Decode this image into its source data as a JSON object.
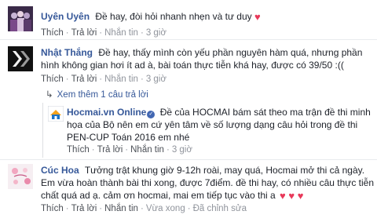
{
  "comments": [
    {
      "name": "Uyên Uyên",
      "text": "Đề hay, đòi hỏi nhanh nhẹn và tư duy",
      "hearts": "♥",
      "actions": {
        "like": "Thích",
        "reply": "Trả lời",
        "message": "Nhắn tin",
        "time": "3 giờ"
      }
    },
    {
      "name": "Nhật Thắng",
      "text": "Đề hay, thấy mình còn yếu phần nguyên hàm quá, nhưng phần hình không gian hơi ít ad à, bài toán thực tiễn khá hay, được có 39/50 :((",
      "actions": {
        "like": "Thích",
        "reply": "Trả lời",
        "message": "Nhắn tin",
        "time": "3 giờ"
      },
      "see_replies": "Xem thêm 1 câu trả lời",
      "reply": {
        "name": "Hocmai.vn Online",
        "verified": "✓",
        "text": "Đề của HOCMAI bám sát theo ma trận đề thi minh họa của Bộ nên em cứ yên tâm về số lượng dạng câu hỏi trong đề thi PEN-CUP Toán 2016 em nhé",
        "actions": {
          "like": "Thích",
          "reply": "Trả lời",
          "message": "Nhắn tin",
          "time": "3 giờ"
        }
      }
    },
    {
      "name": "Cúc Hoa",
      "text": "Tưởng trật khung giờ 9-12h roài, may quá, Hocmai mở thi cả ngày. Em vừa hoàn thành bài thi xong, được 7điểm. đề thi hay, có nhiều câu thực tiễn chất quá ad ạ. cảm ơn hocmai, mai em tiếp tục vào thi a",
      "hearts": "♥ ♥ ♥",
      "actions": {
        "like": "Thích",
        "reply": "Trả lời",
        "message": "Nhắn tin",
        "status": "Vừa xong",
        "edited": "Đã chỉnh sửa"
      }
    }
  ]
}
